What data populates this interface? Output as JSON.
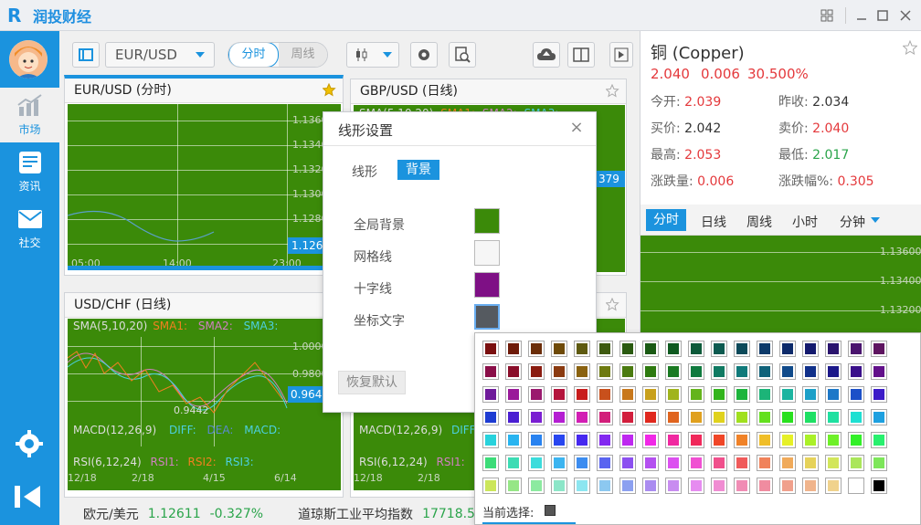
{
  "app": {
    "name": "润投财经",
    "logo_mark": "R"
  },
  "window": {
    "icons": [
      "grid-icon",
      "minimize-icon",
      "maximize-icon",
      "close-icon"
    ]
  },
  "sidebar": {
    "items": [
      {
        "label": "市场",
        "icon": "chart-icon"
      },
      {
        "label": "资讯",
        "icon": "news-icon"
      },
      {
        "label": "社交",
        "icon": "mail-icon"
      }
    ]
  },
  "toolbar": {
    "pair": "EUR/USD",
    "segment": {
      "on": "分时",
      "off": "周线"
    }
  },
  "panels": {
    "p1": {
      "title": "EUR/USD (分时)",
      "yticks": [
        "1.1360",
        "1.1340",
        "1.1320",
        "1.1300",
        "1.1280"
      ],
      "xticks": [
        "05:00",
        "14:00",
        "23:00"
      ],
      "last": "1.1261"
    },
    "p2": {
      "title": "GBP/USD (日线)",
      "indicators": [
        "SMA(5,10,20)",
        "SMA1:",
        "SMA2:",
        "SMA3:"
      ],
      "last": "379"
    },
    "p3": {
      "title": "USD/CHF (日线)",
      "sma": [
        "SMA(5,10,20)",
        "SMA1:",
        "SMA2:",
        "SMA3:"
      ],
      "yticks": [
        "1.0000",
        "0.9800"
      ],
      "last": "0.9648",
      "low_label": "0.9442",
      "macd": [
        "MACD(12,26,9)",
        "DIFF:",
        "DEA:",
        "MACD:"
      ],
      "rsi": [
        "RSI(6,12,24)",
        "RSI1:",
        "RSI2:",
        "RSI3:"
      ],
      "xticks": [
        "12/18",
        "2/18",
        "4/15",
        "6/14"
      ]
    },
    "p4": {
      "macd": "MACD(12,26,9)",
      "diff": "DIFF",
      "rsi": "RSI(6,12,24)",
      "rsi1": "RSI1:",
      "xticks": [
        "12/18",
        "2/18"
      ]
    }
  },
  "info": {
    "name": "铜 (Copper)",
    "price": "2.040",
    "change": "0.006",
    "change_pct": "30.500%",
    "open_label": "今开:",
    "open": "2.039",
    "prev_label": "昨收:",
    "prev": "2.034",
    "bid_label": "买价:",
    "bid": "2.042",
    "ask_label": "卖价:",
    "ask": "2.040",
    "high_label": "最高:",
    "high": "2.053",
    "low_label": "最低:",
    "low": "2.017",
    "chg_label": "涨跌量:",
    "chg": "0.006",
    "chgpct_label": "涨跌幅%:",
    "chgpct": "0.305",
    "tabs": [
      "分时",
      "日线",
      "周线",
      "小时",
      "分钟"
    ],
    "yticks": [
      "1.13600",
      "1.13400",
      "1.13200"
    ]
  },
  "ticker": {
    "name1": "欧元/美元",
    "price1": "1.12611",
    "pct1": "-0.327%",
    "name2": "道琼斯工业平均指数",
    "price2": "17718.5"
  },
  "dialog": {
    "title": "线形设置",
    "tab_line": "线形",
    "tab_bg": "背景",
    "rows": [
      {
        "label": "全局背景",
        "color": "#3b8a09"
      },
      {
        "label": "网格线",
        "color": "#f6f6f6"
      },
      {
        "label": "十字线",
        "color": "#7e1085"
      },
      {
        "label": "坐标文字",
        "color": "#555a60"
      }
    ],
    "reset": "恢复默认"
  },
  "palette": {
    "current_label": "当前选择:",
    "current_color": "#555555",
    "rows": [
      [
        "#7a1010",
        "#6e1a08",
        "#6b2d08",
        "#6e4a08",
        "#5e5a10",
        "#3e5a10",
        "#2a5a10",
        "#1a5a14",
        "#0f5a20",
        "#0d5a3a",
        "#0d5a50",
        "#0d4a5a",
        "#0d3a6a",
        "#0d2a6a",
        "#141a6e",
        "#2a146e",
        "#4a146e",
        "#5e1460"
      ],
      [
        "#8a0e48",
        "#8a0e2a",
        "#8a1c10",
        "#8a3a10",
        "#8a6210",
        "#6e7a10",
        "#4a7a10",
        "#2e7a10",
        "#1a7a22",
        "#107a3e",
        "#107a62",
        "#107a7a",
        "#10627a",
        "#104a8a",
        "#10308a",
        "#1c188a",
        "#3a108a",
        "#62108a"
      ],
      [
        "#6e1a9a",
        "#9a1a9a",
        "#9a1a6e",
        "#b4143c",
        "#c81c1c",
        "#c8501c",
        "#c8781c",
        "#c8a01c",
        "#a0b41c",
        "#64b41c",
        "#32b41c",
        "#1cb43c",
        "#1cb478",
        "#1cb4a0",
        "#1ca0c8",
        "#1c78c8",
        "#1c50c8",
        "#3c1cc8"
      ],
      [
        "#1e3cd2",
        "#4a1ed2",
        "#7a1ed2",
        "#b41ed2",
        "#d21eb4",
        "#d21e7a",
        "#d21e3c",
        "#e0281e",
        "#e0641e",
        "#e0a01e",
        "#e0d21e",
        "#a0e01e",
        "#64e01e",
        "#28e01e",
        "#1ee064",
        "#1ee0a0",
        "#1ee0d2",
        "#1ea0e0"
      ],
      [
        "#28d2dc",
        "#28b4f0",
        "#2882f0",
        "#2846f0",
        "#4628f0",
        "#8228f0",
        "#be28f0",
        "#f028e6",
        "#f028a0",
        "#f0285a",
        "#f04628",
        "#f08228",
        "#f0be28",
        "#e6f028",
        "#aaf028",
        "#6ef028",
        "#32f028",
        "#28f06e"
      ],
      [
        "#3cdc78",
        "#3cdcb4",
        "#3cdcdc",
        "#3cb4f0",
        "#3c8cf0",
        "#5a64f0",
        "#8c50f0",
        "#b450f0",
        "#dc50f0",
        "#f050d2",
        "#f0508c",
        "#f05a5a",
        "#f0825a",
        "#f0aa5a",
        "#e6d25a",
        "#d2e65a",
        "#aae65a",
        "#7de65a"
      ],
      [
        "#cce65a",
        "#96e686",
        "#8ceaa0",
        "#8ce6c8",
        "#8ce6f0",
        "#8cc8f0",
        "#8ca0f0",
        "#aa8cf0",
        "#c88cf0",
        "#e68cf0",
        "#f08cd2",
        "#f08cb4",
        "#f08ca0",
        "#f0a08c",
        "#f0b48c",
        "#f0d28c",
        "#ffffff",
        "#000000"
      ]
    ]
  }
}
